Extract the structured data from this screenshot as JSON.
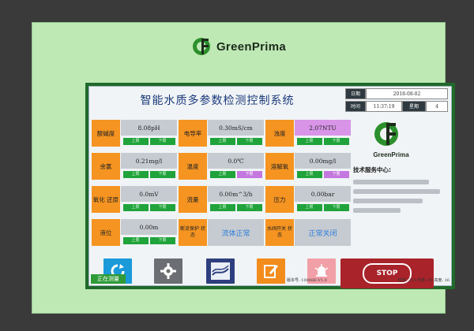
{
  "device": {
    "brand": "GreenPrima"
  },
  "title": "智能水质多参数检测控制系统",
  "datetime": {
    "date_label": "日期",
    "date_value": "2018-08-02",
    "time_label": "时间",
    "time_value": "11:37:19",
    "weekday_label": "星期",
    "weekday_value": "4"
  },
  "params": [
    {
      "label": "酸碱度",
      "value": "8.08pH",
      "limits": [
        "上限",
        "下限"
      ]
    },
    {
      "label": "电导率",
      "value": "0.30mS/cm",
      "limits": [
        "上限",
        "下限"
      ]
    },
    {
      "label": "浊度",
      "value": "2.07NTU",
      "limits": [
        "上限",
        "下限"
      ]
    },
    {
      "label": "余氯",
      "value": "0.21mg/l",
      "limits": [
        "上限",
        "下限"
      ]
    },
    {
      "label": "温度",
      "value": "0.0℃",
      "limits": [
        "上限",
        "下限"
      ]
    },
    {
      "label": "溶解氧",
      "value": "0.00mg/l",
      "limits": [
        "上限",
        "下限"
      ]
    },
    {
      "label": "氧化 还原",
      "value": "0.0mV",
      "limits": [
        "上限",
        "下限"
      ]
    },
    {
      "label": "流量",
      "value": "0.00m^3/h",
      "limits": [
        "上限",
        "下限"
      ]
    },
    {
      "label": "压力",
      "value": "0.00bar",
      "limits": [
        "上限",
        "下限"
      ]
    },
    {
      "label": "液位",
      "value": "0.00m",
      "limits": [
        "上限",
        "下限"
      ]
    },
    {
      "label": "断流保护 状态",
      "status": "流体正常"
    },
    {
      "label": "水阀开关 状态",
      "status": "正常关闭"
    }
  ],
  "right": {
    "brand": "GreenPrima",
    "tech_label": "技术服务中心:"
  },
  "buttons": {
    "refresh": "refresh-icon",
    "settings": "gear-icon",
    "chart": "chart-icon",
    "edit": "edit-icon",
    "alarm": "alarm-icon",
    "stop_label": "STOP"
  },
  "status": {
    "measuring": "正在测量",
    "version": "版本号: 10068E-V1.0",
    "footer_right": "经度: 255  纬度: 99  高度: 16"
  },
  "colors": {
    "orange": "#f59421",
    "value_gray": "#c6cbd1",
    "pink": "#d895e8",
    "green": "#20a33a",
    "stop_red": "#a8232a",
    "title_blue": "#1b3a7a"
  }
}
